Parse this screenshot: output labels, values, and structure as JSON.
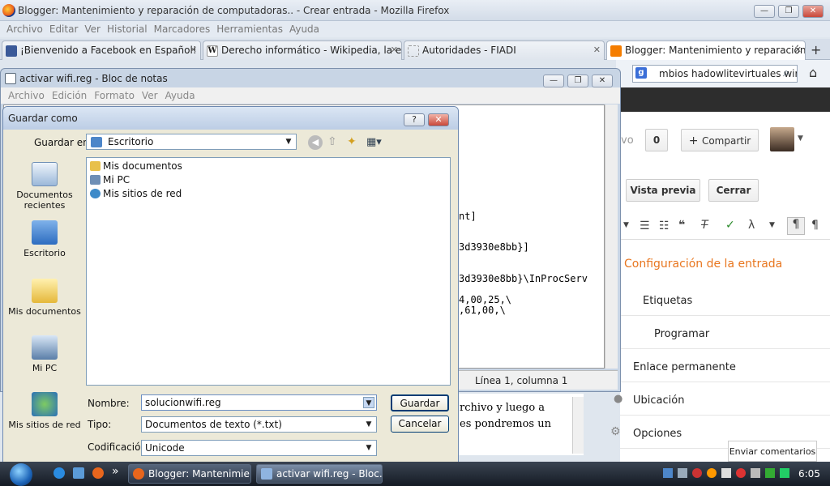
{
  "firefox": {
    "title": "Blogger: Mantenimiento y reparación de computadoras.. - Crear entrada - Mozilla Firefox",
    "menu": [
      "Archivo",
      "Editar",
      "Ver",
      "Historial",
      "Marcadores",
      "Herramientas",
      "Ayuda"
    ],
    "tabs": [
      {
        "label": "¡Bienvenido a Facebook en Español!"
      },
      {
        "label": "Derecho informático - Wikipedia, la e..."
      },
      {
        "label": "Autoridades - FIADI"
      },
      {
        "label": "Blogger: Mantenimiento y reparación..."
      }
    ],
    "new_tab": "+",
    "search_value": "mbios hadowlitevirtuales wir"
  },
  "blogger": {
    "count": "0",
    "share_label": "Compartir",
    "partial_label": "vo",
    "preview_label": "Vista previa",
    "close_label": "Cerrar",
    "settings_title": "Configuración de la entrada",
    "settings": [
      "Etiquetas",
      "Programar",
      "Enlace permanente",
      "Ubicación",
      "Opciones"
    ],
    "feedback": "Enviar comentarios"
  },
  "notepad": {
    "title": "activar wifi.reg - Bloc de notas",
    "menu": [
      "Archivo",
      "Edición",
      "Formato",
      "Ver",
      "Ayuda"
    ],
    "lines": [
      "nt]",
      "3d3930e8bb}]",
      "3d3930e8bb}\\InProcServ",
      "4,00,25,\\",
      ",61,00,\\"
    ],
    "status": "Línea 1, columna 1",
    "lower_text": [
      "rchivo y luego a",
      "es pondremos un"
    ]
  },
  "dialog": {
    "title": "Guardar como",
    "help": "?",
    "save_in_label": "Guardar en:",
    "save_in_value": "Escritorio",
    "places": [
      "Documentos recientes",
      "Escritorio",
      "Mis documentos",
      "Mi PC",
      "Mis sitios de red"
    ],
    "files": [
      "Mis documentos",
      "Mi PC",
      "Mis sitios de red"
    ],
    "name_label": "Nombre:",
    "name_value": "solucionwifi.reg",
    "type_label": "Tipo:",
    "type_value": "Documentos de texto (*.txt)",
    "encoding_label": "Codificación:",
    "encoding_value": "Unicode",
    "save_button": "Guardar",
    "cancel_button": "Cancelar"
  },
  "taskbar": {
    "more": "»",
    "buttons": [
      "Blogger: Mantenimie...",
      "activar wifi.reg - Bloc..."
    ],
    "clock": "6:05"
  }
}
